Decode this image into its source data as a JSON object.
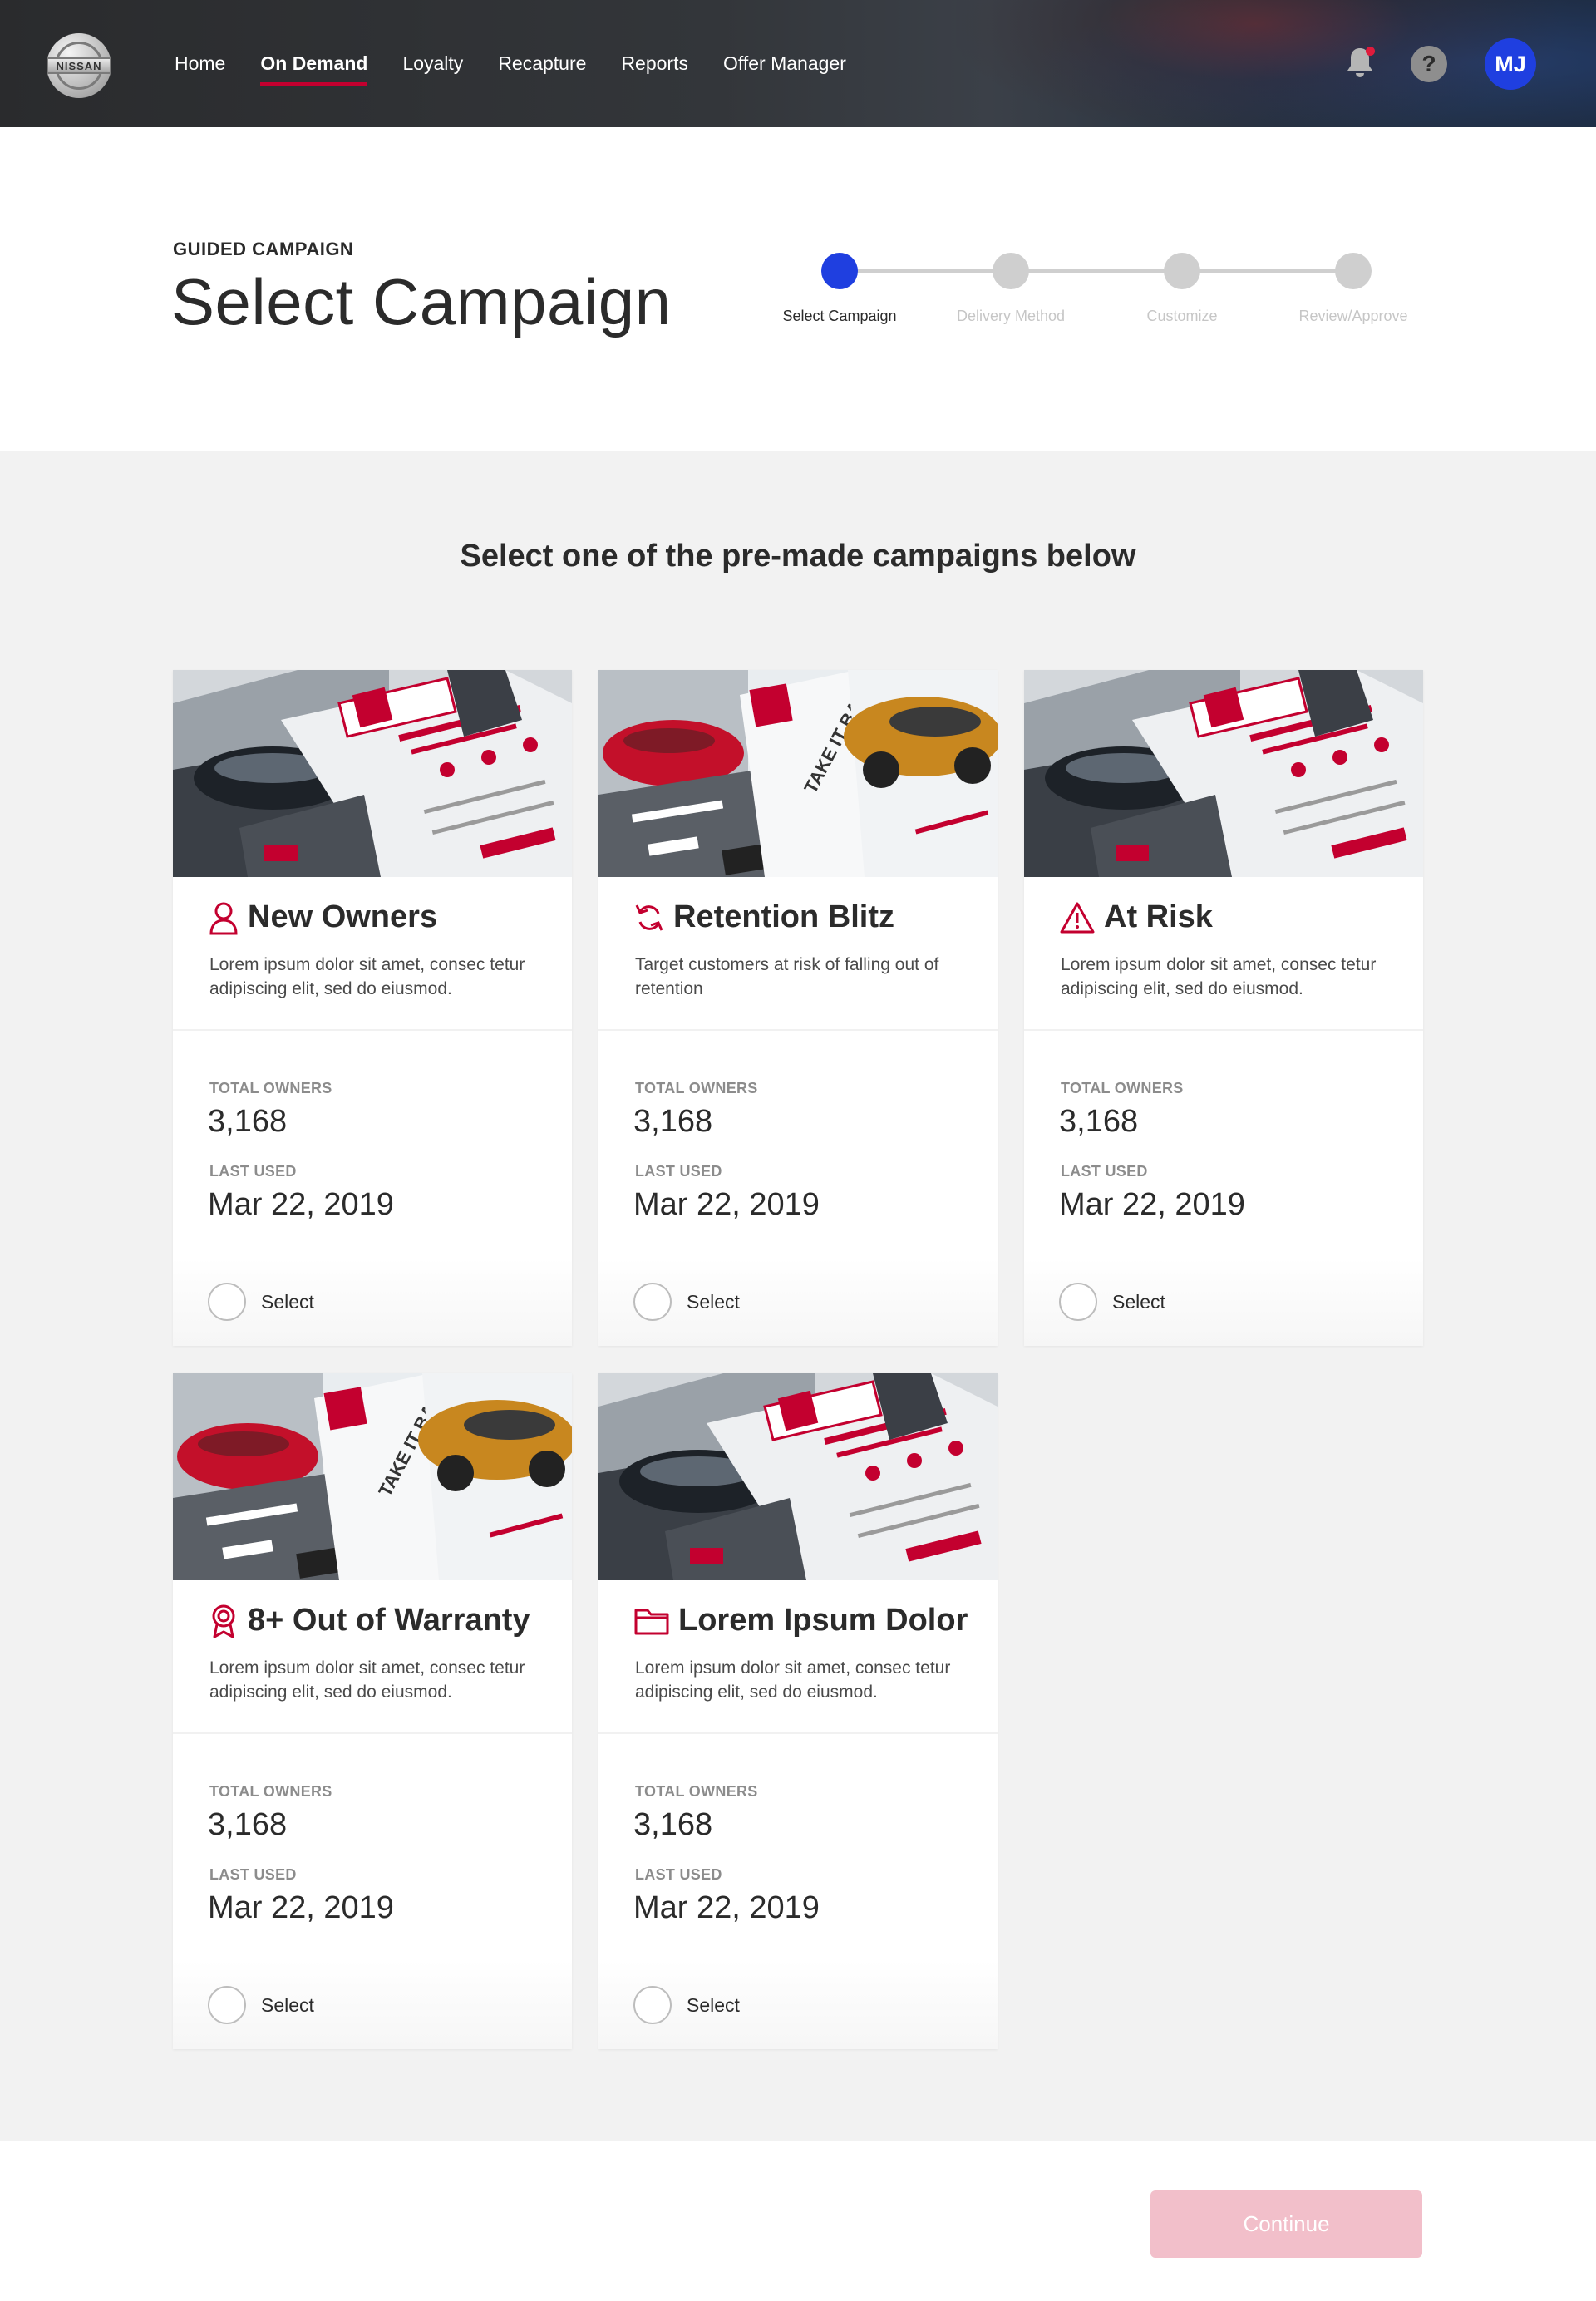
{
  "nav": {
    "logo_text": "NISSAN",
    "items": [
      {
        "label": "Home",
        "active": false
      },
      {
        "label": "On Demand",
        "active": true
      },
      {
        "label": "Loyalty",
        "active": false
      },
      {
        "label": "Recapture",
        "active": false
      },
      {
        "label": "Reports",
        "active": false
      },
      {
        "label": "Offer Manager",
        "active": false
      }
    ],
    "icons": [
      "bell-icon",
      "help-icon"
    ],
    "help_glyph": "?",
    "avatar_initials": "MJ"
  },
  "header": {
    "eyebrow": "GUIDED CAMPAIGN",
    "title": "Select Campaign"
  },
  "stepper": {
    "steps": [
      {
        "label": "Select Campaign",
        "active": true
      },
      {
        "label": "Delivery Method",
        "active": false
      },
      {
        "label": "Customize",
        "active": false
      },
      {
        "label": "Review/Approve",
        "active": false
      }
    ]
  },
  "main": {
    "subtitle": "Select one of the pre-made campaigns below"
  },
  "cards": [
    {
      "icon": "person-icon",
      "title": "New Owners",
      "desc": "Lorem ipsum dolor sit amet, consec tetur adipiscing elit, sed do eiusmod.",
      "total_owners_label": "TOTAL OWNERS",
      "total_owners": "3,168",
      "last_used_label": "LAST USED",
      "last_used": "Mar 22, 2019",
      "select_label": "Select",
      "thumb": "parts"
    },
    {
      "icon": "refresh-icon",
      "title": "Retention Blitz",
      "desc": "Target customers at risk of falling out of retention",
      "total_owners_label": "TOTAL OWNERS",
      "total_owners": "3,168",
      "last_used_label": "LAST USED",
      "last_used": "Mar 22, 2019",
      "select_label": "Select",
      "thumb": "truck"
    },
    {
      "icon": "warning-icon",
      "title": "At Risk",
      "desc": "Lorem ipsum dolor sit amet, consec tetur adipiscing elit, sed do eiusmod.",
      "total_owners_label": "TOTAL OWNERS",
      "total_owners": "3,168",
      "last_used_label": "LAST USED",
      "last_used": "Mar 22, 2019",
      "select_label": "Select",
      "thumb": "parts"
    },
    {
      "icon": "award-icon",
      "title": "8+ Out of Warranty",
      "desc": "Lorem ipsum dolor sit amet, consec tetur adipiscing elit, sed do eiusmod.",
      "total_owners_label": "TOTAL OWNERS",
      "total_owners": "3,168",
      "last_used_label": "LAST USED",
      "last_used": "Mar 22, 2019",
      "select_label": "Select",
      "thumb": "truck"
    },
    {
      "icon": "folder-icon",
      "title": "Lorem Ipsum Dolor",
      "desc": "Lorem ipsum dolor sit amet, consec tetur adipiscing elit, sed do eiusmod.",
      "total_owners_label": "TOTAL OWNERS",
      "total_owners": "3,168",
      "last_used_label": "LAST USED",
      "last_used": "Mar 22, 2019",
      "select_label": "Select",
      "thumb": "parts"
    }
  ],
  "footer": {
    "continue_label": "Continue"
  },
  "colors": {
    "brand_red": "#c3002f",
    "accent_blue": "#1f3fe0",
    "disabled_button": "#f2bfca"
  }
}
